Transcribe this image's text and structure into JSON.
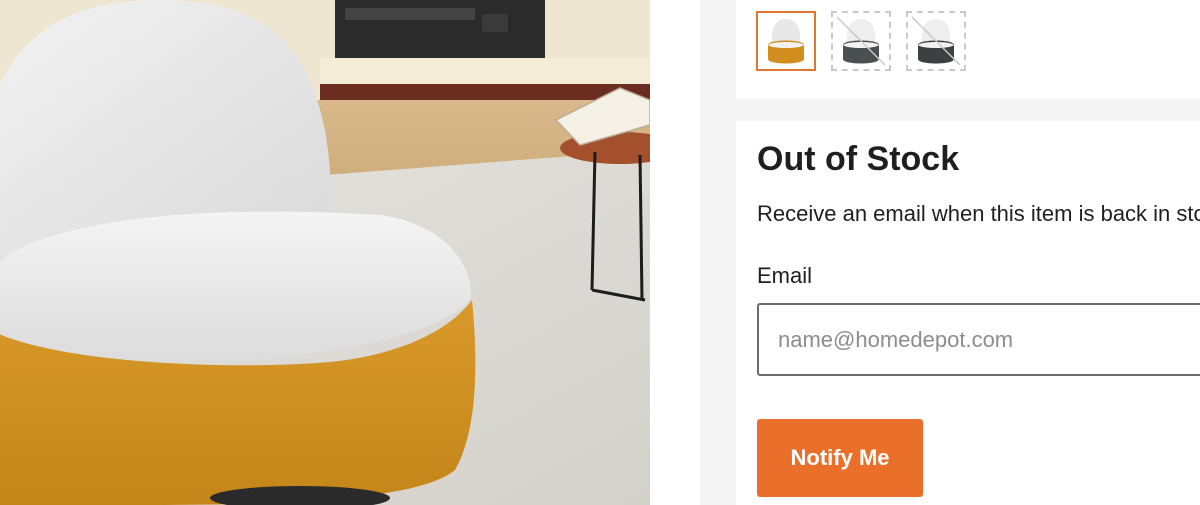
{
  "swatches": [
    {
      "label": "",
      "state": "selected"
    },
    {
      "label": "",
      "state": "unavailable"
    },
    {
      "label": "",
      "state": "unavailable"
    }
  ],
  "stock": {
    "title": "Out of Stock",
    "description": "Receive an email when this item is back in stock",
    "email_label": "Email",
    "email_placeholder": "name@homedepot.com",
    "email_value": "",
    "notify_label": "Notify Me"
  },
  "colors": {
    "accent": "#e96f2a",
    "swatch_selected_border": "#e0762f",
    "panel_background": "#f4f4f4"
  }
}
